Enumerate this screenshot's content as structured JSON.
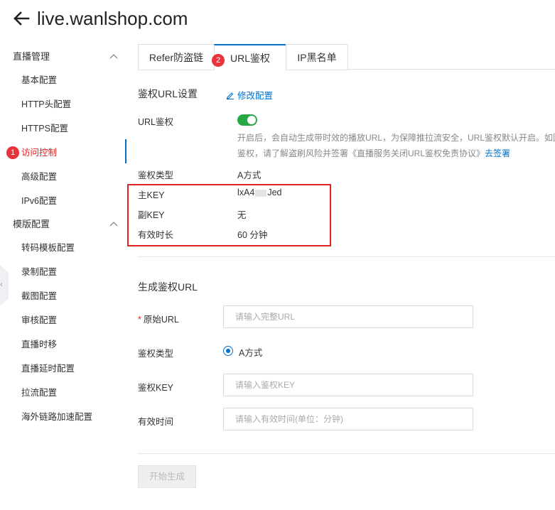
{
  "header": {
    "title": "live.wanlshop.com"
  },
  "sidebar": {
    "groups": [
      {
        "label": "直播管理"
      },
      {
        "label": "模版配置"
      }
    ],
    "items": [
      {
        "label": "基本配置"
      },
      {
        "label": "HTTP头配置"
      },
      {
        "label": "HTTPS配置"
      },
      {
        "label": "访问控制"
      },
      {
        "label": "高级配置"
      },
      {
        "label": "IPv6配置"
      },
      {
        "label": "转码模板配置"
      },
      {
        "label": "录制配置"
      },
      {
        "label": "截图配置"
      },
      {
        "label": "审核配置"
      },
      {
        "label": "直播时移"
      },
      {
        "label": "直播延时配置"
      },
      {
        "label": "拉流配置"
      },
      {
        "label": "海外链路加速配置"
      }
    ],
    "collapse_glyph": "‹"
  },
  "annotations": {
    "badge1": "1",
    "badge2": "2"
  },
  "tabs": [
    {
      "label": "Refer防盗链"
    },
    {
      "label": "URL鉴权"
    },
    {
      "label": "IP黑名单"
    }
  ],
  "auth": {
    "section_title": "鉴权URL设置",
    "edit_label": "修改配置",
    "url_auth_label": "URL鉴权",
    "desc_line1": "开启后，会自动生成带时效的播放URL，为保障推拉流安全，URL鉴权默认开启。如因",
    "desc_line2_prefix": "鉴权，请了解盗刷风险并签署《直播服务关闭URL鉴权免责协议》",
    "desc_line2_link": "去签署",
    "type_label": "鉴权类型",
    "type_value": "A方式",
    "main_key_label": "主KEY",
    "main_key_prefix": "lxA4",
    "main_key_suffix": "Jed",
    "sub_key_label": "副KEY",
    "sub_key_value": "无",
    "duration_label": "有效时长",
    "duration_value": "60 分钟"
  },
  "generate": {
    "section_title": "生成鉴权URL",
    "required_mark": "*",
    "orig_url_label": "原始URL",
    "orig_url_placeholder": "请输入完整URL",
    "type_label": "鉴权类型",
    "type_option": "A方式",
    "key_label": "鉴权KEY",
    "key_placeholder": "请输入鉴权KEY",
    "time_label": "有效时间",
    "time_placeholder": "请输入有效时间(单位：分钟)",
    "button_label": "开始生成"
  },
  "colors": {
    "accent": "#0070cc",
    "toggle_on": "#28a745",
    "highlight": "#e02424",
    "badge": "#e8323c"
  }
}
